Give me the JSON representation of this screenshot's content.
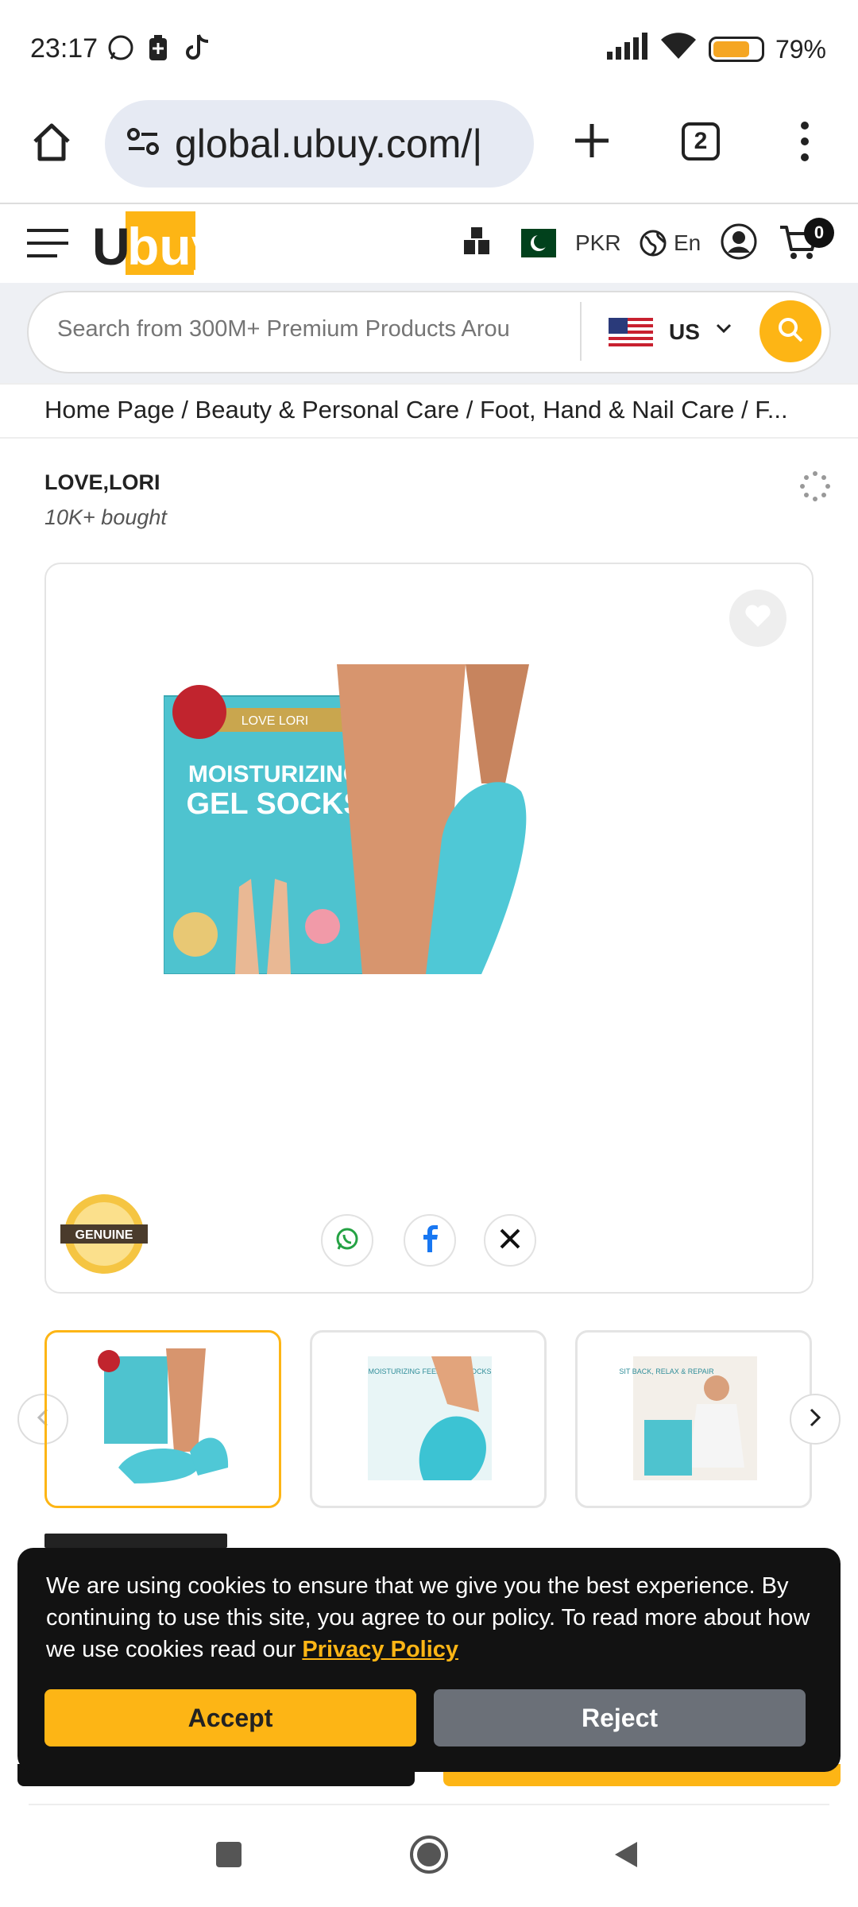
{
  "status_bar": {
    "time": "23:17",
    "battery_percent": "79%",
    "battery_level": 0.79
  },
  "browser": {
    "url": "global.ubuy.com/|",
    "tab_count": "2"
  },
  "header": {
    "logo_prefix": "U",
    "logo_highlight": "buy",
    "currency": "PKR",
    "language": "En",
    "cart_count": "0"
  },
  "search": {
    "placeholder": "Search from 300M+ Premium Products Arou",
    "country": "US"
  },
  "breadcrumb": "Home Page / Beauty & Personal Care / Foot, Hand & Nail Care / F...",
  "product": {
    "brand": "LOVE,LORI",
    "bought": "10K+ bought",
    "image_box_title": "MOISTURIZING",
    "image_box_subtitle": "GEL SOCKS",
    "image_box_brand": "LOVE LORI",
    "badge_text": "GENUINE"
  },
  "thumbnails": [
    {
      "caption": ""
    },
    {
      "caption": "MOISTURIZING FEEL-GOOD SOCKS"
    },
    {
      "caption": "SIT BACK, RELAX & REPAIR"
    }
  ],
  "cookie": {
    "text": "We are using cookies to ensure that we give you the best experience. By continuing to use this site, you agree to our policy. To read more about how we use cookies read our",
    "link": "Privacy Policy",
    "accept": "Accept",
    "reject": "Reject"
  },
  "colors": {
    "accent": "#fdb515",
    "dark": "#121212",
    "reject": "#6b7078"
  }
}
